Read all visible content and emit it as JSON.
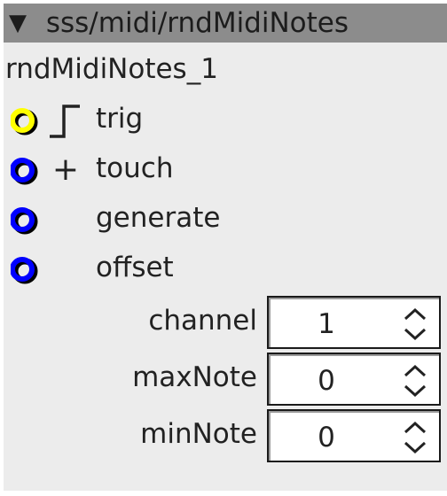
{
  "window": {
    "collapse_glyph": "▼",
    "path": "sss/midi/rndMidiNotes"
  },
  "instance": {
    "name": "rndMidiNotes_1"
  },
  "inlets": [
    {
      "label": "trig",
      "port_color": "#ffff00",
      "glyph": "trigger-edge-icon"
    },
    {
      "label": "touch",
      "port_color": "#0000ff",
      "glyph": "+"
    },
    {
      "label": "generate",
      "port_color": "#0000ff",
      "glyph": ""
    },
    {
      "label": "offset",
      "port_color": "#0000ff",
      "glyph": ""
    }
  ],
  "params": [
    {
      "label": "channel",
      "value": "1"
    },
    {
      "label": "maxNote",
      "value": "0"
    },
    {
      "label": "minNote",
      "value": "0"
    }
  ],
  "colors": {
    "panel_bg": "#ececec",
    "titlebar_bg": "#8c8c8c",
    "port_outline": "#000000",
    "port_trigger": "#ffff00",
    "port_value": "#0000ff"
  }
}
